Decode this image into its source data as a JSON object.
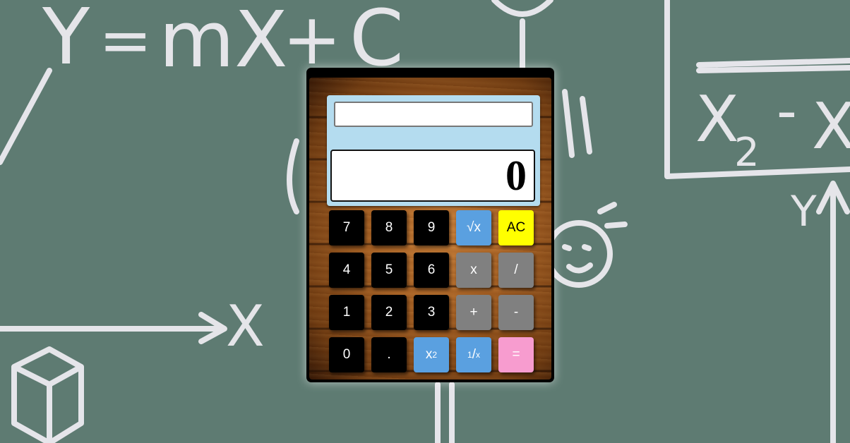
{
  "display": {
    "expression": "",
    "result": "0"
  },
  "keys": {
    "k7": "7",
    "k8": "8",
    "k9": "9",
    "sqrt": "√x",
    "clear": "AC",
    "k4": "4",
    "k5": "5",
    "k6": "6",
    "multiply": "x",
    "divide": "/",
    "k1": "1",
    "k2": "2",
    "k3": "3",
    "add": "+",
    "subtract": "-",
    "k0": "0",
    "decimal": ".",
    "square_base": "x",
    "square_exp": "2",
    "reciprocal_num": "1",
    "reciprocal_slash": "/",
    "reciprocal_den": "x",
    "equals": "="
  },
  "chalk": {
    "formula_y": "Y",
    "formula_eq": "=",
    "formula_mx": "mX",
    "formula_plus": "+",
    "formula_c": "C",
    "x_label": "X",
    "minus": "-",
    "x2_base": "X",
    "x2_sub": "2",
    "x_right": "X",
    "y_axis_label": "Y"
  },
  "colors": {
    "chalkboard": "#5e7b72",
    "chalk": "#f1eef4",
    "display_panel": "#b4dcef",
    "key_number": "#000000",
    "key_operator": "#808080",
    "key_function": "#5aa0e0",
    "key_clear": "#ffff00",
    "key_equals": "#f79ccf"
  }
}
